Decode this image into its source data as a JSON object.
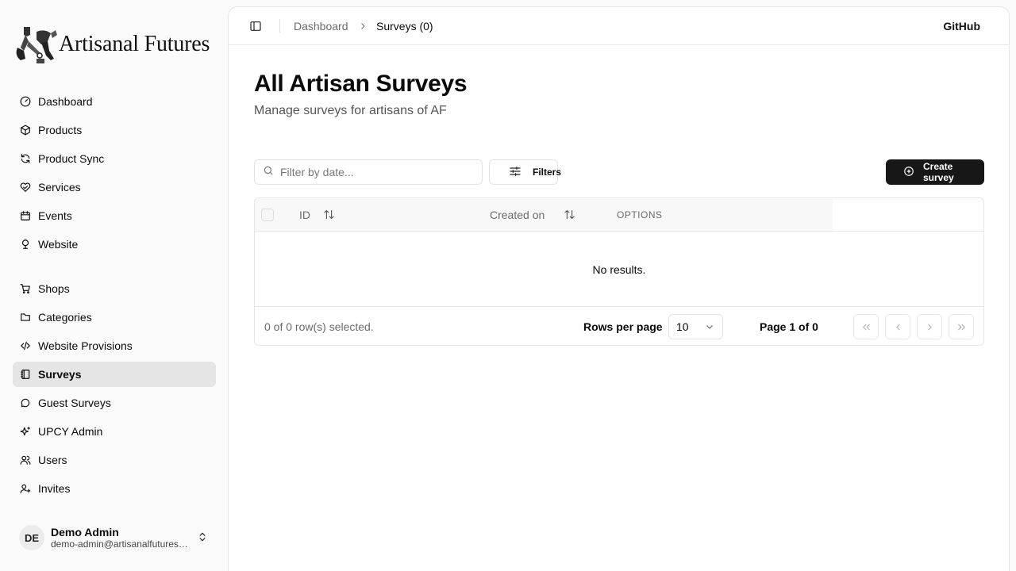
{
  "brand": {
    "name": "Artisanal Futures"
  },
  "sidebar": {
    "primary": [
      {
        "label": "Dashboard",
        "icon": "gauge-icon"
      },
      {
        "label": "Products",
        "icon": "package-icon"
      },
      {
        "label": "Product Sync",
        "icon": "refresh-icon"
      },
      {
        "label": "Services",
        "icon": "heart-handshake-icon"
      },
      {
        "label": "Events",
        "icon": "calendar-icon"
      },
      {
        "label": "Website",
        "icon": "globe-stand-icon"
      }
    ],
    "secondary": [
      {
        "label": "Shops",
        "icon": "cart-icon"
      },
      {
        "label": "Categories",
        "icon": "folder-icon"
      },
      {
        "label": "Website Provisions",
        "icon": "code-icon"
      },
      {
        "label": "Surveys",
        "icon": "notebook-icon",
        "active": true
      },
      {
        "label": "Guest Surveys",
        "icon": "message-circle-icon"
      },
      {
        "label": "UPCY Admin",
        "icon": "sparkles-icon"
      },
      {
        "label": "Users",
        "icon": "users-icon"
      },
      {
        "label": "Invites",
        "icon": "user-plus-icon"
      }
    ]
  },
  "user": {
    "initials": "DE",
    "name": "Demo Admin",
    "email": "demo-admin@artisanalfutures.org"
  },
  "header": {
    "breadcrumb_root": "Dashboard",
    "breadcrumb_current": "Surveys (0)",
    "github_label": "GitHub"
  },
  "page": {
    "title": "All Artisan Surveys",
    "subtitle": "Manage surveys for artisans of AF"
  },
  "toolbar": {
    "search_placeholder": "Filter by date...",
    "filters_label": "Filters",
    "create_label": "Create survey"
  },
  "table": {
    "columns": [
      "ID",
      "Created on",
      "OPTIONS"
    ],
    "empty_text": "No results.",
    "selected_text": "0 of 0 row(s) selected.",
    "rows_per_page_label": "Rows per page",
    "rows_per_page_value": "10",
    "page_info": "Page 1 of 0"
  },
  "colors": {
    "accent": "#171717",
    "active_nav_bg": "#e5e5e5",
    "sidebar_bg": "#fafafa"
  }
}
